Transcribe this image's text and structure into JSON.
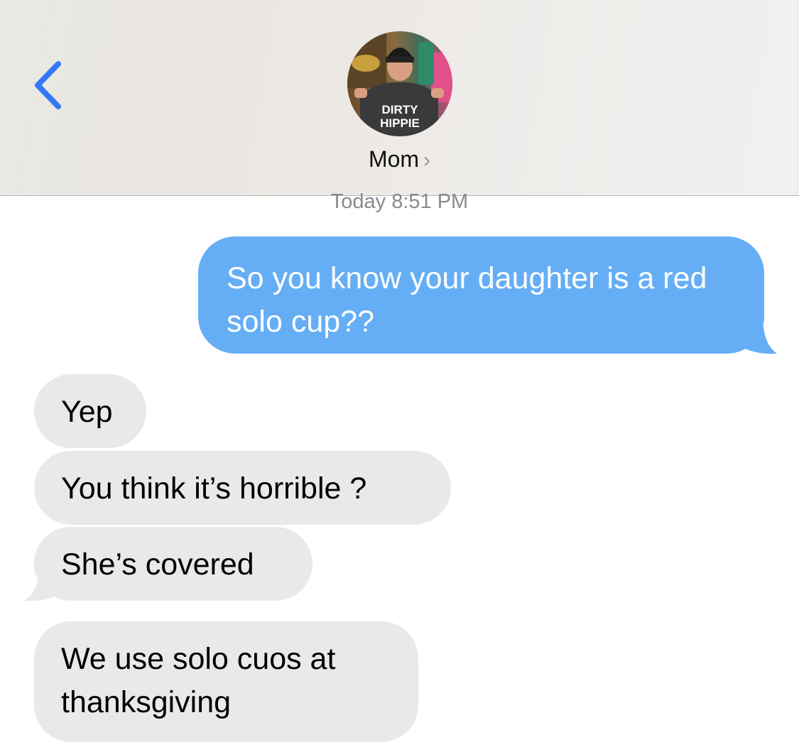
{
  "header": {
    "back_icon": "chevron-left-icon",
    "contact_name": "Mom",
    "chevron": "›",
    "avatar_shirt_line1": "DIRTY",
    "avatar_shirt_line2": "HIPPIE"
  },
  "timestamp": "Today 8:51 PM",
  "messages": [
    {
      "direction": "sent",
      "text": "So you know your daughter is a red solo cup??"
    },
    {
      "direction": "received",
      "text": "Yep"
    },
    {
      "direction": "received",
      "text": "You think it’s horrible ?"
    },
    {
      "direction": "received",
      "text": "She’s covered"
    },
    {
      "direction": "received",
      "text": "We use solo cuos at thanksgiving"
    }
  ],
  "colors": {
    "sent_bubble": "#65aef5",
    "received_bubble": "#e9e9eb",
    "accent": "#3478f6"
  }
}
